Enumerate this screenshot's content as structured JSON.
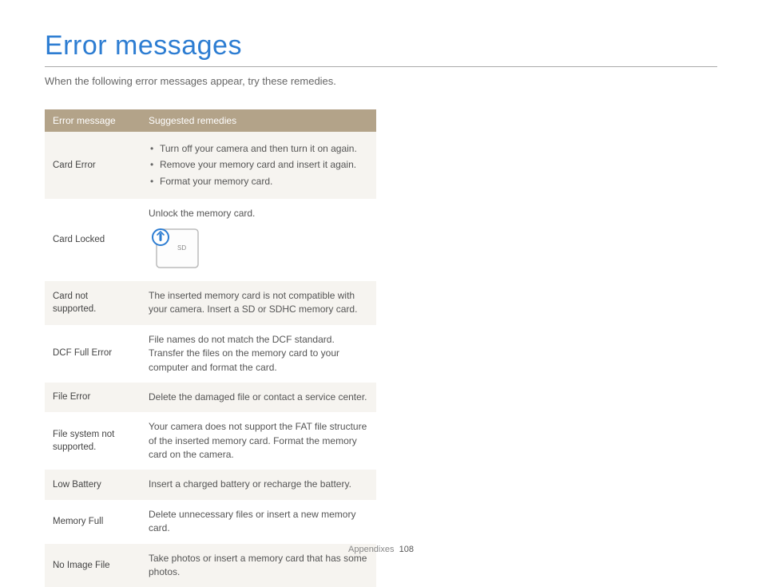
{
  "title": "Error messages",
  "intro": "When the following error messages appear, try these remedies.",
  "headers": {
    "col1": "Error message",
    "col2": "Suggested remedies"
  },
  "rows": {
    "r0": {
      "msg": "Card Error",
      "b0": "Turn off your camera and then turn it on again.",
      "b1": "Remove your memory card and insert it again.",
      "b2": "Format your memory card."
    },
    "r1": {
      "msg": "Card Locked",
      "text": "Unlock the memory card.",
      "sdLabel": "SD"
    },
    "r2": {
      "msg": "Card not supported.",
      "text": "The inserted memory card is not compatible with your camera. Insert a SD or SDHC memory card."
    },
    "r3": {
      "msg": "DCF Full Error",
      "text": "File names do not match the DCF standard. Transfer the files on the memory card to your computer and format the card."
    },
    "r4": {
      "msg": "File Error",
      "text": "Delete the damaged file or contact a service center."
    },
    "r5": {
      "msg": "File system not supported.",
      "text": "Your camera does not support the FAT file structure of the inserted memory card. Format the memory card on the camera."
    },
    "r6": {
      "msg": "Low Battery",
      "text": "Insert a charged battery or recharge the battery."
    },
    "r7": {
      "msg": "Memory Full",
      "text": "Delete unnecessary files or insert a new memory card."
    },
    "r8": {
      "msg": "No Image File",
      "text": "Take photos or insert a memory card that has some photos."
    }
  },
  "footer": {
    "section": "Appendixes",
    "page": "108"
  }
}
